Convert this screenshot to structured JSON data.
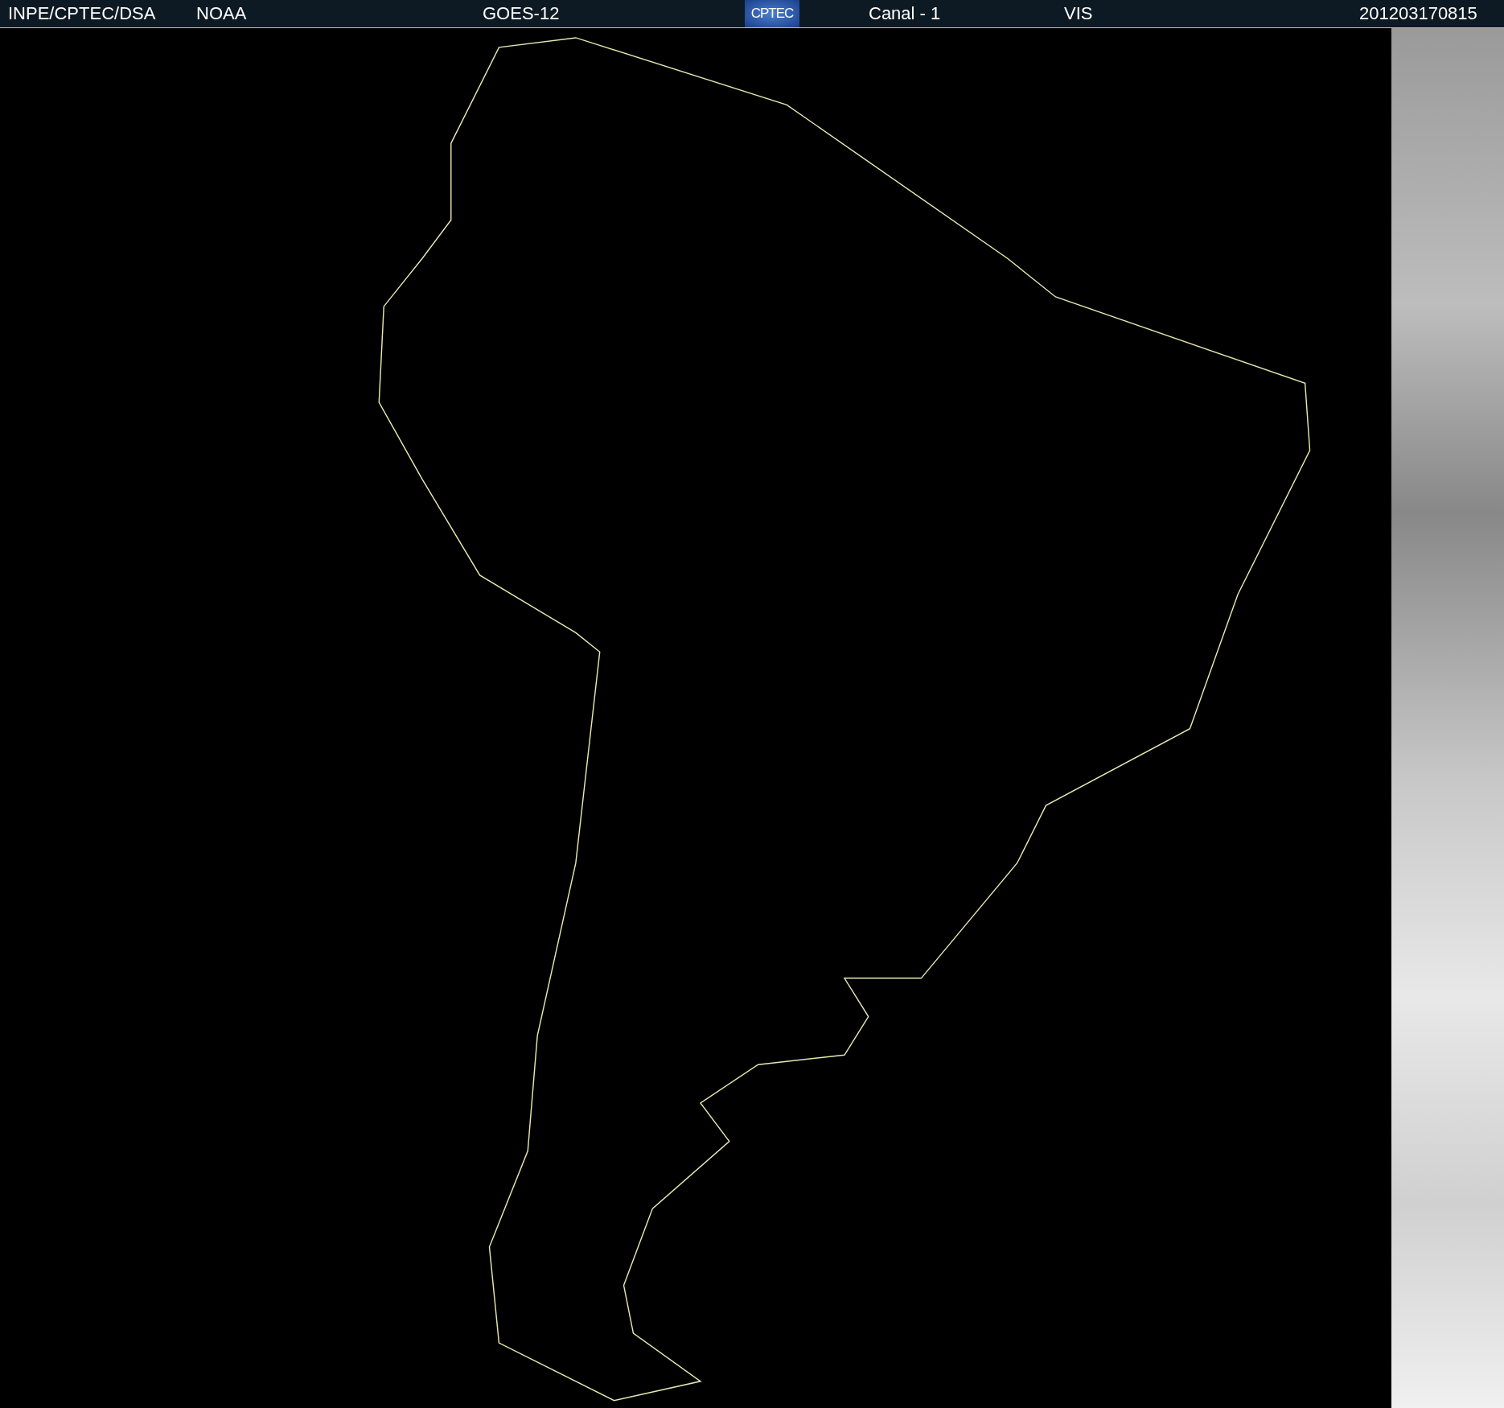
{
  "header": {
    "items": [
      {
        "kind": "text",
        "text": "INPE/CPTEC/DSA"
      },
      {
        "kind": "text",
        "text": "NOAA"
      },
      {
        "kind": "text",
        "text": "GOES-12"
      },
      {
        "kind": "logo",
        "text": "CPTEC"
      },
      {
        "kind": "text",
        "text": "Canal - 1"
      },
      {
        "kind": "text",
        "text": "VIS"
      },
      {
        "kind": "text",
        "text": "201203170815"
      }
    ]
  }
}
